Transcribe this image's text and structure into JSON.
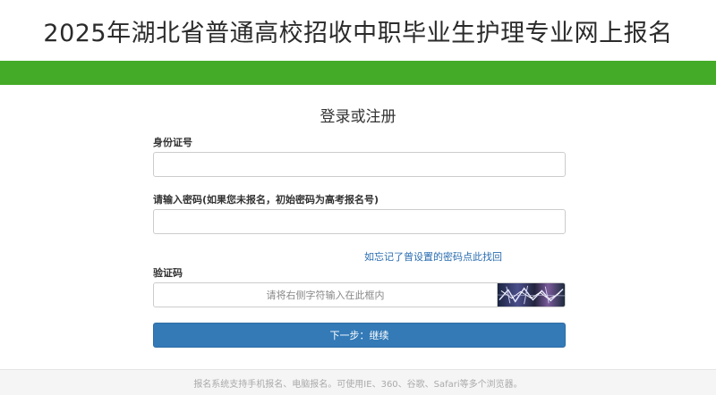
{
  "header": {
    "title": "2025年湖北省普通高校招收中职毕业生护理专业网上报名"
  },
  "theme": {
    "bar_color": "#44ab28",
    "button_color": "#337ab7",
    "link_color": "#2a6db0"
  },
  "form": {
    "title": "登录或注册",
    "id_label": "身份证号",
    "id_value": "",
    "password_label": "请输入密码(如果您未报名，初始密码为高考报名号)",
    "password_value": "",
    "forgot_link": "如忘记了曾设置的密码点此找回",
    "captcha_label": "验证码",
    "captcha_placeholder": "请将右侧字符输入在此框内",
    "next_button": "下一步：继续"
  },
  "footer": {
    "text": "报名系统支持手机报名、电脑报名。可使用IE、360、谷歌、Safari等多个浏览器。"
  }
}
